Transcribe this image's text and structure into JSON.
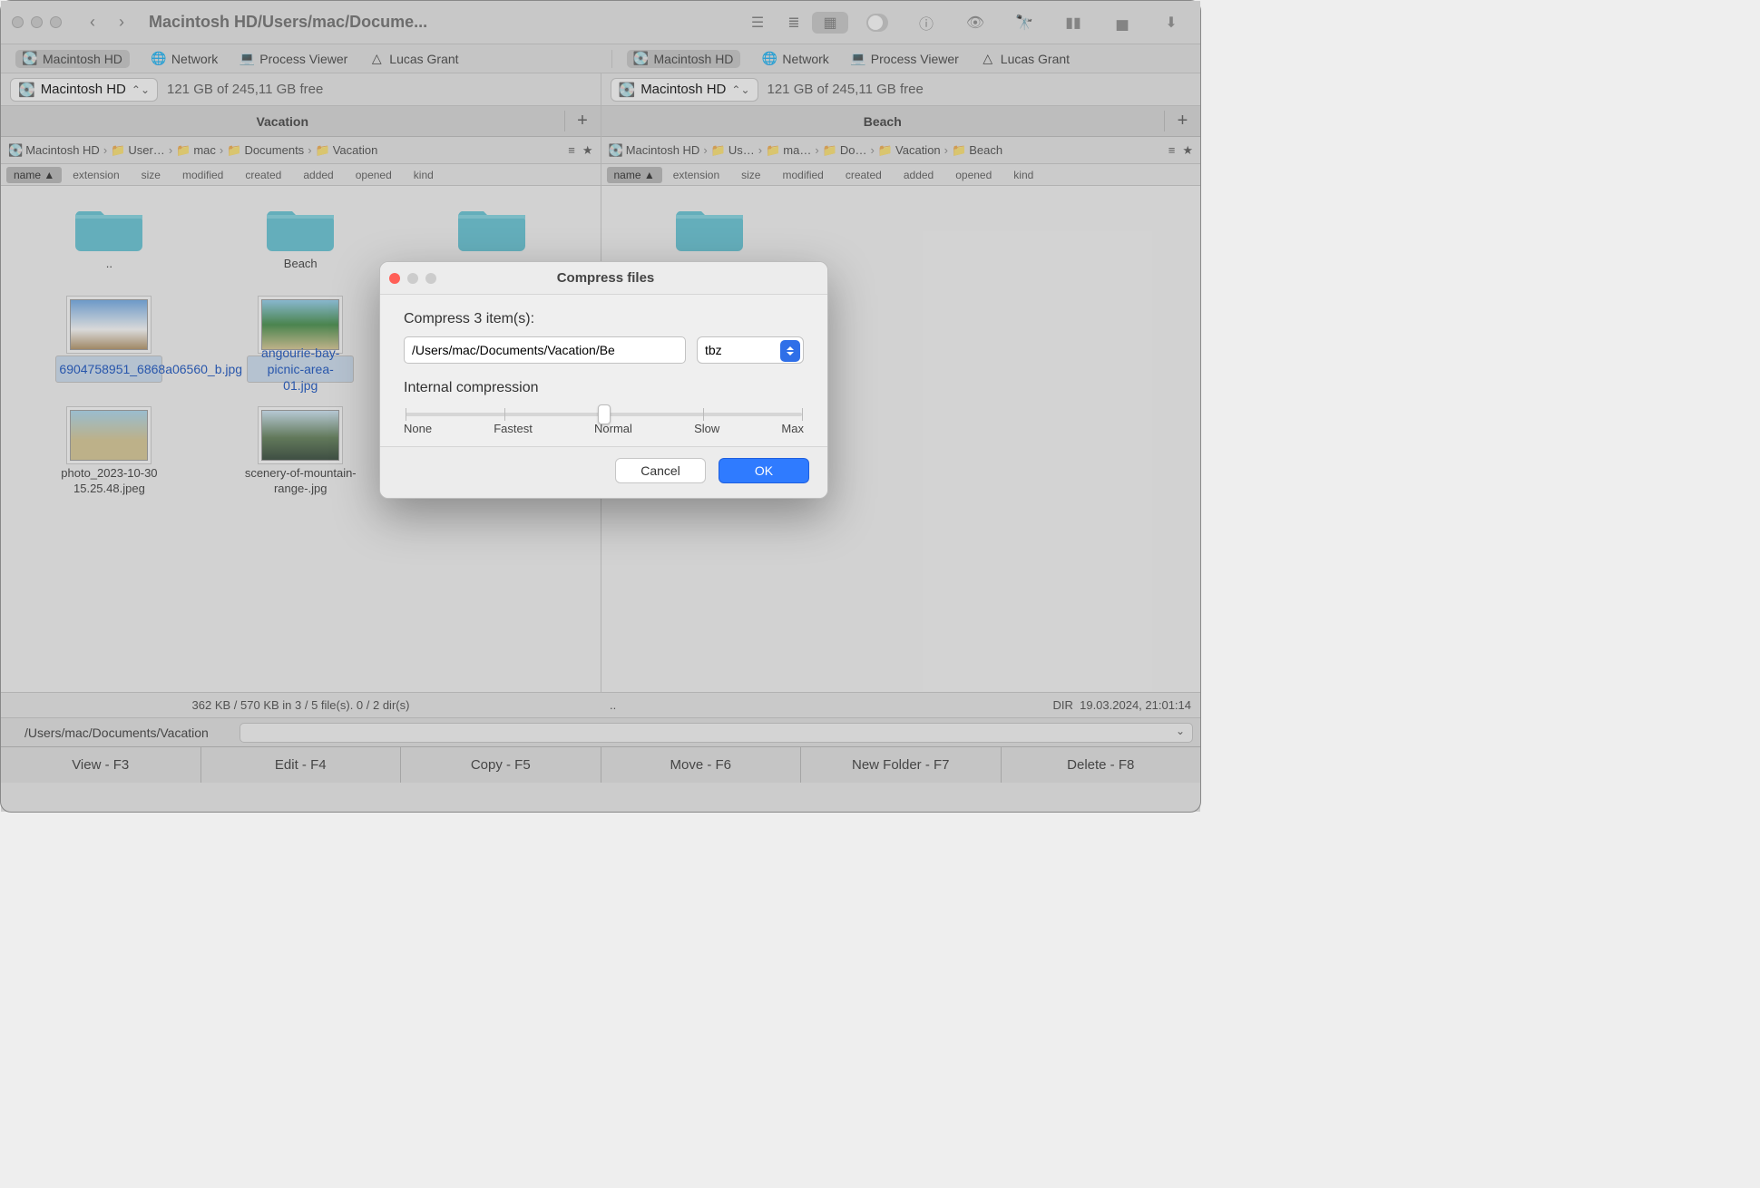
{
  "window": {
    "title": "Macintosh HD/Users/mac/Docume..."
  },
  "shelf": {
    "left": [
      {
        "label": "Macintosh HD",
        "icon": "hd",
        "pill": true
      },
      {
        "label": "Network",
        "icon": "globe"
      },
      {
        "label": "Process Viewer",
        "icon": "laptop"
      },
      {
        "label": "Lucas Grant",
        "icon": "gdrive"
      }
    ],
    "right": [
      {
        "label": "Macintosh HD",
        "icon": "hd",
        "pill": true
      },
      {
        "label": "Network",
        "icon": "globe"
      },
      {
        "label": "Process Viewer",
        "icon": "laptop"
      },
      {
        "label": "Lucas Grant",
        "icon": "gdrive"
      }
    ]
  },
  "panes": {
    "left": {
      "disk": "Macintosh HD",
      "free": "121 GB of 245,11 GB free",
      "tab": "Vacation",
      "crumbs": [
        "Macintosh HD",
        "User…",
        "mac",
        "Documents",
        "Vacation"
      ],
      "columns": [
        "name",
        "extension",
        "size",
        "modified",
        "created",
        "added",
        "opened",
        "kind"
      ],
      "items": [
        {
          "type": "folder",
          "label": ".."
        },
        {
          "type": "folder",
          "label": "Beach"
        },
        {
          "type": "folder",
          "label": ""
        },
        {
          "type": "image",
          "label": "6904758951_6868a06560_b.jpg",
          "sel": true
        },
        {
          "type": "image",
          "label": "angourie-bay-picnic-area-01.jpg",
          "sel": true
        },
        {
          "type": "blank"
        },
        {
          "type": "image",
          "label": "photo_2023-10-30 15.25.48.jpeg"
        },
        {
          "type": "image",
          "label": "scenery-of-mountain-range-.jpg"
        }
      ],
      "status": "362 KB / 570 KB in 3 / 5 file(s). 0 / 2 dir(s)"
    },
    "right": {
      "disk": "Macintosh HD",
      "free": "121 GB of 245,11 GB free",
      "tab": "Beach",
      "crumbs": [
        "Macintosh HD",
        "Us…",
        "ma…",
        "Do…",
        "Vacation",
        "Beach"
      ],
      "columns": [
        "name",
        "extension",
        "size",
        "modified",
        "created",
        "added",
        "opened",
        "kind"
      ],
      "items": [
        {
          "type": "folder",
          "label": ""
        }
      ],
      "status_prefix": "..",
      "status_kind": "DIR",
      "status_dt": "19.03.2024, 21:01:14"
    }
  },
  "bottom_path": "/Users/mac/Documents/Vacation",
  "fkeys": [
    "View - F3",
    "Edit - F4",
    "Copy - F5",
    "Move - F6",
    "New Folder - F7",
    "Delete - F8"
  ],
  "modal": {
    "title": "Compress files",
    "heading": "Compress 3 item(s):",
    "path_value": "/Users/mac/Documents/Vacation/Be",
    "format": "tbz",
    "slider_label": "Internal compression",
    "slider_ticks": [
      "None",
      "Fastest",
      "Normal",
      "Slow",
      "Max"
    ],
    "cancel": "Cancel",
    "ok": "OK"
  }
}
